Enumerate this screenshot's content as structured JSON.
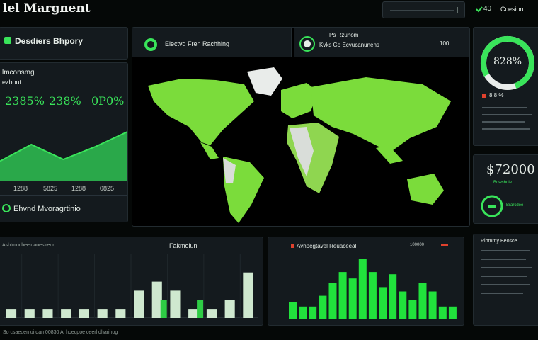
{
  "header": {
    "title": "lel Margnent",
    "search_placeholder": "",
    "icon_value": "40",
    "user_label": "Ccesion"
  },
  "left_panel": {
    "title": "Desdiers Bhpory",
    "subtitle": "lmconsmg",
    "subtitle2": "ezhout",
    "stats": [
      "2385%",
      "238%",
      "0P0%"
    ],
    "chart_data": {
      "type": "area",
      "categories": [
        "1288",
        "5825",
        "1288",
        "0825"
      ],
      "values": [
        18,
        34,
        20,
        32,
        46
      ],
      "ylim": [
        0,
        60
      ]
    },
    "footer_label": "Ehvnd Mvoragrtinio"
  },
  "map_panel": {
    "title": "Electvd Fren Rachhing",
    "info_title": "Ps Rzuhom",
    "info_sub": "Kvks Go Ecvucanunens",
    "info_value": "100"
  },
  "right_panel": {
    "gauge_value": "828%",
    "gauge_fraction": 0.78,
    "legend_label": "8.8 %",
    "amount": "$72000",
    "amount_label": "Bowshole",
    "toggle_label": "Brarcdee",
    "list_title": "Rlbmrny  Beosce"
  },
  "bottom_left": {
    "header_left": "Asbtmocheeloaoeslrenr",
    "header_mid": "Fakmolun",
    "chart_data": {
      "type": "bar",
      "series": [
        {
          "name": "light",
          "values": [
            2,
            2,
            2,
            2,
            2,
            2,
            2,
            6,
            8,
            6,
            2,
            2,
            4,
            10
          ]
        },
        {
          "name": "green",
          "values": [
            0,
            0,
            0,
            0,
            0,
            0,
            0,
            0,
            4,
            0,
            4,
            0,
            0,
            0
          ]
        }
      ],
      "ylim": [
        0,
        14
      ]
    },
    "footer_text": "So csaeuen ui dan 00830 Ai hoecpoe ceerl dharinog"
  },
  "bottom_mid": {
    "title": "Avnpegtavel Reuaceeal",
    "legend": "100000",
    "chart_data": {
      "type": "bar",
      "values": [
        8,
        6,
        6,
        11,
        17,
        22,
        19,
        28,
        22,
        15,
        21,
        13,
        9,
        17,
        13,
        6,
        6
      ],
      "ylim": [
        0,
        30
      ]
    }
  },
  "colors": {
    "accent": "#39e45a",
    "alert": "#e0412d",
    "panel": "#141a1e",
    "map_land": "#7bdc3b"
  }
}
